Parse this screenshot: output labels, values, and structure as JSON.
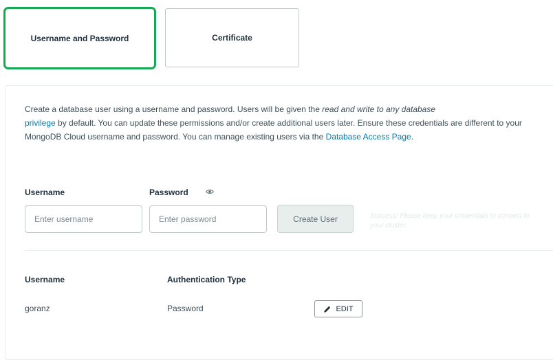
{
  "tabs": [
    {
      "label": "Username and Password",
      "active": true
    },
    {
      "label": "Certificate",
      "active": false
    }
  ],
  "description": {
    "part1": "Create a database user using a username and password. Users will be given the ",
    "italic": "read and write to any database",
    "link1": "privilege",
    "part2": " by default. You can update these permissions and/or create additional users later. Ensure these credentials are different to your MongoDB Cloud username and password. You can manage existing users via the ",
    "link2": "Database Access Page",
    "part3": "."
  },
  "form": {
    "username_label": "Username",
    "password_label": "Password",
    "username_placeholder": "Enter username",
    "password_placeholder": "Enter password",
    "create_button": "Create User",
    "success_message": "Success! Please keep your credentials to connect to your cluster."
  },
  "users_table": {
    "headers": [
      "Username",
      "Authentication Type"
    ],
    "rows": [
      {
        "username": "goranz",
        "auth_type": "Password",
        "action": "EDIT"
      }
    ]
  },
  "colors": {
    "active_tab_border": "#13aa52",
    "link": "#007cad"
  },
  "icons": {
    "password_visibility": "eye-icon",
    "edit": "pencil-icon"
  }
}
